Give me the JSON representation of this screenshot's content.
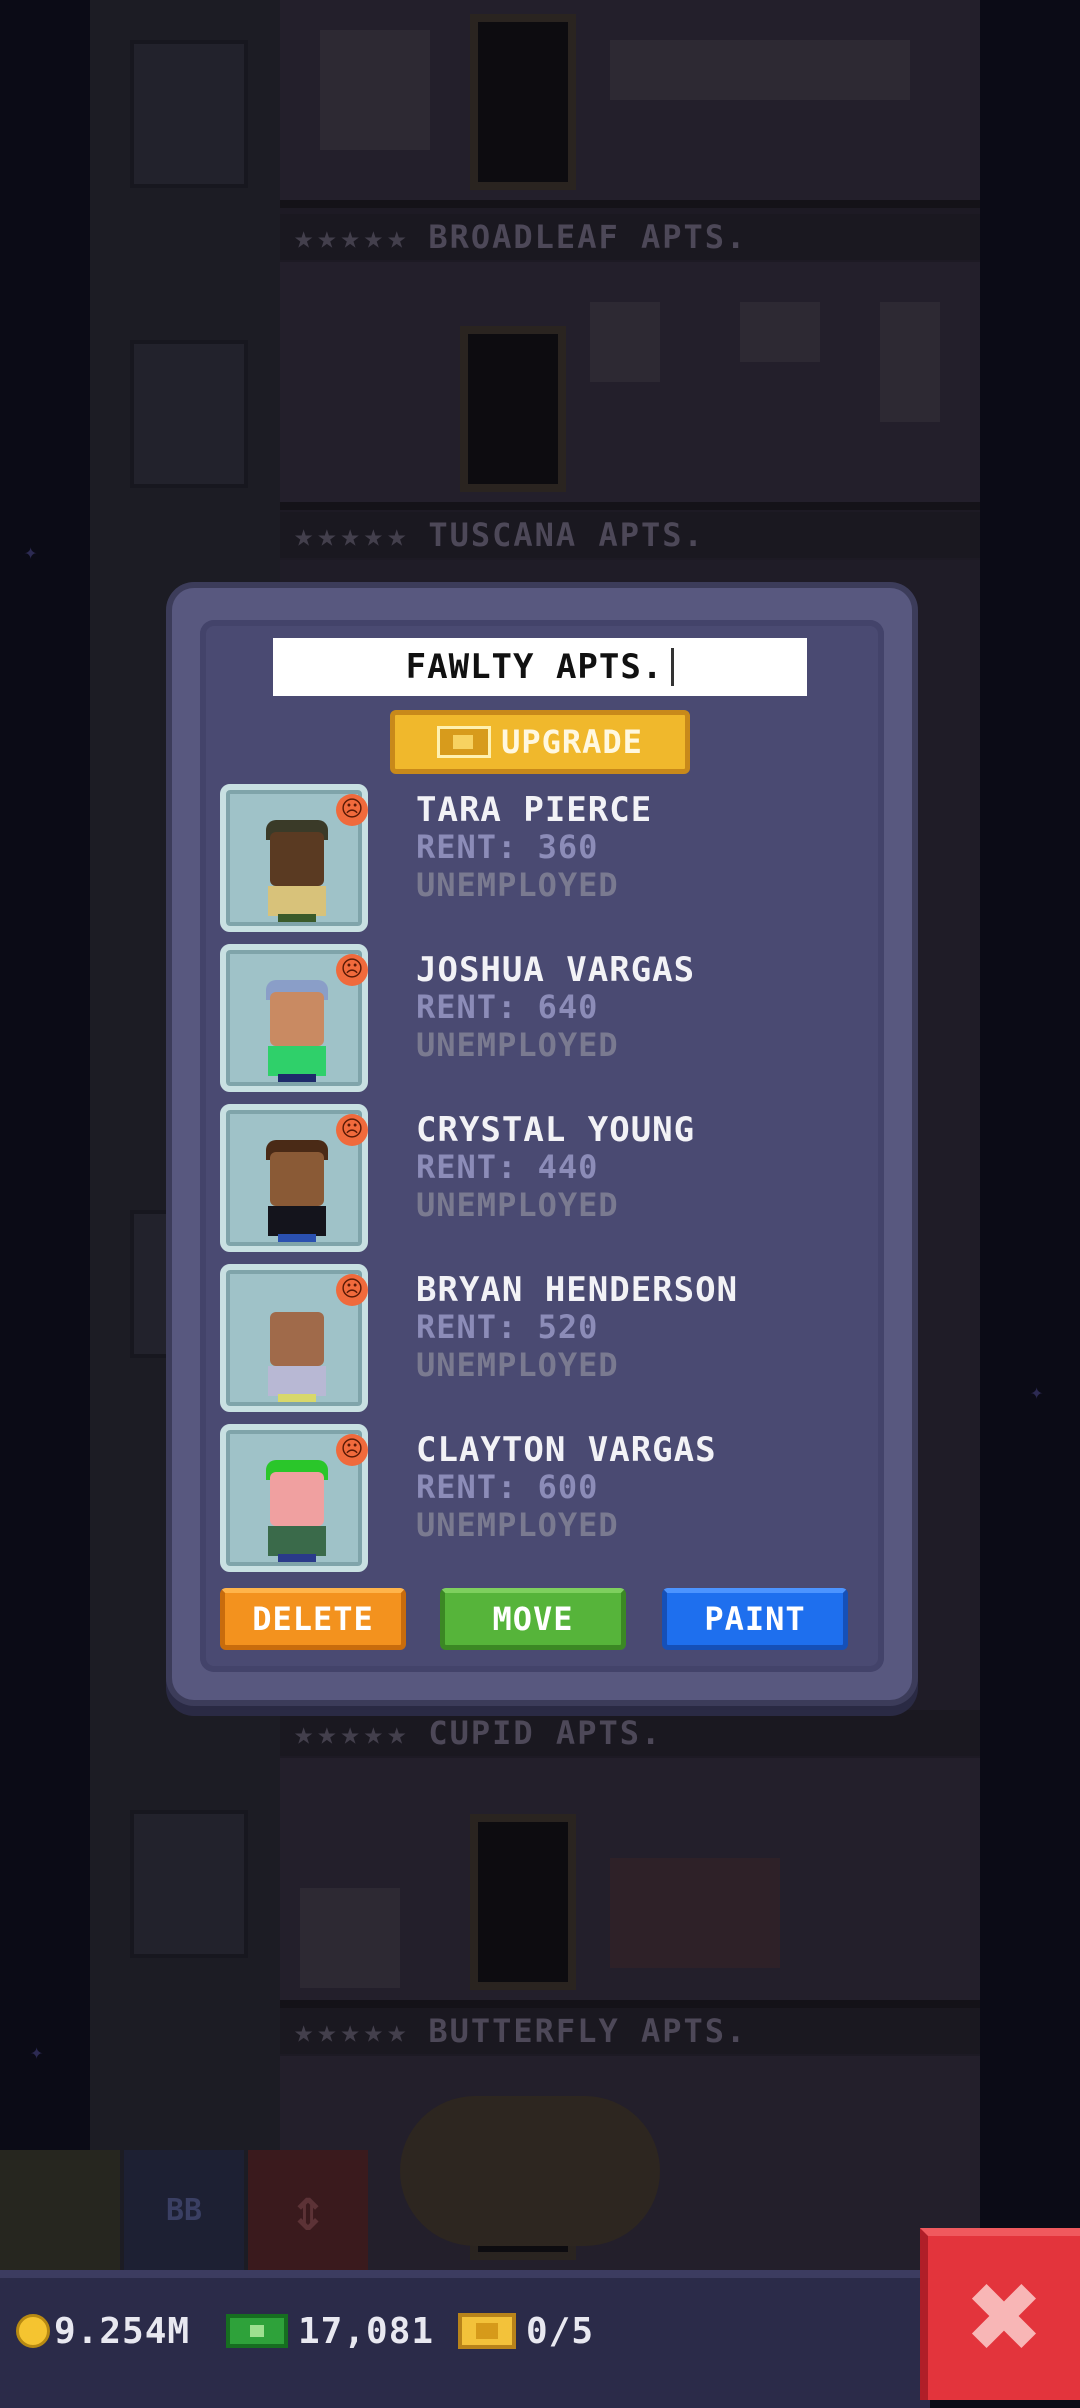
{
  "background": {
    "floors": [
      {
        "stars": "★★★★★",
        "name": "BROADLEAF APTS."
      },
      {
        "stars": "★★★★★",
        "name": "TUSCANA APTS."
      },
      {
        "stars": "★★★★★",
        "name": "CUPID APTS."
      },
      {
        "stars": "★★★★★",
        "name": "BUTTERFLY APTS."
      }
    ],
    "build_buttons": [
      {
        "label": ""
      },
      {
        "label": "BB"
      },
      {
        "label": "⇕"
      }
    ]
  },
  "dialog": {
    "floor_name": "FAWLTY APTS.",
    "upgrade_label": "UPGRADE",
    "tenants": [
      {
        "name": "TARA PIERCE",
        "rent": "RENT: 360",
        "job": "UNEMPLOYED",
        "mood": "☹"
      },
      {
        "name": "JOSHUA VARGAS",
        "rent": "RENT: 640",
        "job": "UNEMPLOYED",
        "mood": "☹"
      },
      {
        "name": "CRYSTAL YOUNG",
        "rent": "RENT: 440",
        "job": "UNEMPLOYED",
        "mood": "☹"
      },
      {
        "name": "BRYAN HENDERSON",
        "rent": "RENT: 520",
        "job": "UNEMPLOYED",
        "mood": "☹"
      },
      {
        "name": "CLAYTON VARGAS",
        "rent": "RENT: 600",
        "job": "UNEMPLOYED",
        "mood": "☹"
      }
    ],
    "actions": {
      "delete_label": "DELETE",
      "move_label": "MOVE",
      "paint_label": "PAINT"
    }
  },
  "status": {
    "coins": "9.254M",
    "bux": "17,081",
    "tickets": "0/5"
  },
  "close_label": "✖",
  "colors": {
    "accent_delete": "#f3921e",
    "accent_move": "#56b43a",
    "accent_paint": "#1e6fee",
    "close": "#e3343c"
  }
}
